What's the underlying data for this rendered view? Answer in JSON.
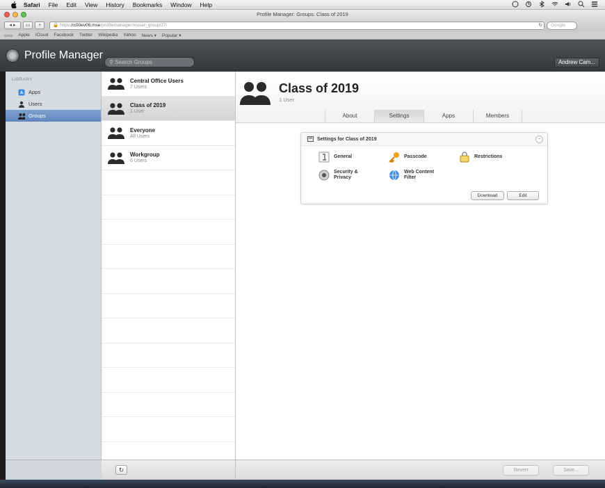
{
  "menubar": {
    "items": [
      "Safari",
      "File",
      "Edit",
      "View",
      "History",
      "Bookmarks",
      "Window",
      "Help"
    ]
  },
  "window": {
    "title": "Profile Manager: Groups: Class of 2019",
    "url_host": "c00ev06.mse",
    "url_scheme": "https",
    "url_path": "/profilemanager/#/user_group/27/"
  },
  "toolbar": {
    "search_placeholder": "Google"
  },
  "bookmarks": [
    "Apple",
    "iCloud",
    "Facebook",
    "Twitter",
    "Wikipedia",
    "Yahoo",
    "News ▾",
    "Popular ▾"
  ],
  "header": {
    "app_title": "Profile Manager",
    "search_placeholder": "Search Groups",
    "user_name": "Andrew Cam..."
  },
  "sidebar": {
    "heading": "LIBRARY",
    "items": [
      {
        "label": "Apps",
        "icon": "app-store-icon"
      },
      {
        "label": "Users",
        "icon": "user-icon"
      },
      {
        "label": "Groups",
        "icon": "group-icon",
        "active": true
      }
    ]
  },
  "groups": [
    {
      "name": "Central Office Users",
      "count": "7 Users"
    },
    {
      "name": "Class of 2019",
      "count": "1 User",
      "selected": true
    },
    {
      "name": "Everyone",
      "count": "All Users"
    },
    {
      "name": "Workgroup",
      "count": "6 Users"
    }
  ],
  "main": {
    "title": "Class of 2019",
    "subtitle": "1 User",
    "tabs": [
      "About",
      "Settings",
      "Apps",
      "Members"
    ],
    "active_tab": "Settings",
    "card": {
      "title": "Settings for Class of 2019",
      "payloads": [
        "General",
        "Passcode",
        "Restrictions",
        "Security & Privacy",
        "Web Content Filter"
      ],
      "download_label": "Download",
      "edit_label": "Edit"
    }
  },
  "footer": {
    "refresh_glyph": "↻",
    "revert_label": "Revert",
    "save_label": "Save..."
  },
  "colors": {
    "header_bg": "#3f4347",
    "sidebar_bg": "#d6dce3",
    "sidebar_active": "#6a8fc4"
  }
}
